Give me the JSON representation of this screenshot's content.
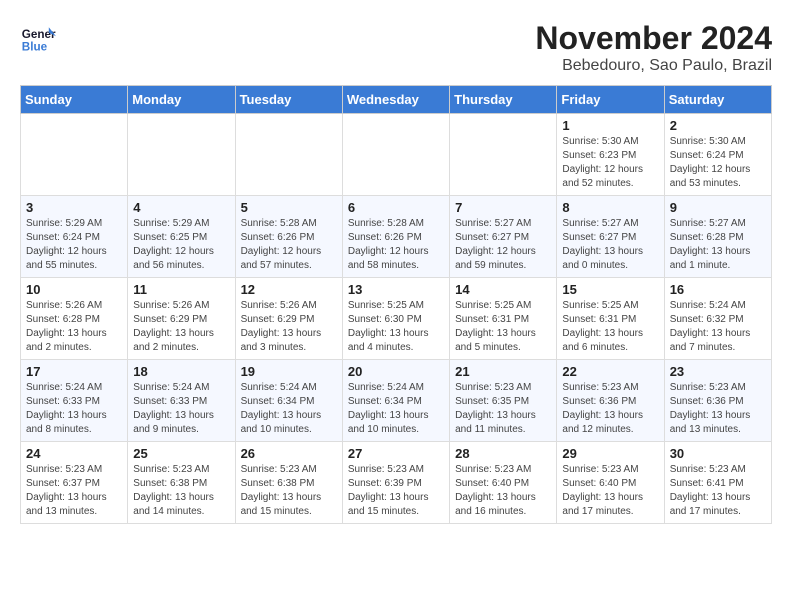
{
  "header": {
    "logo_text_1": "General",
    "logo_text_2": "Blue",
    "month_title": "November 2024",
    "location": "Bebedouro, Sao Paulo, Brazil"
  },
  "weekdays": [
    "Sunday",
    "Monday",
    "Tuesday",
    "Wednesday",
    "Thursday",
    "Friday",
    "Saturday"
  ],
  "weeks": [
    [
      {
        "day": "",
        "info": ""
      },
      {
        "day": "",
        "info": ""
      },
      {
        "day": "",
        "info": ""
      },
      {
        "day": "",
        "info": ""
      },
      {
        "day": "",
        "info": ""
      },
      {
        "day": "1",
        "info": "Sunrise: 5:30 AM\nSunset: 6:23 PM\nDaylight: 12 hours and 52 minutes."
      },
      {
        "day": "2",
        "info": "Sunrise: 5:30 AM\nSunset: 6:24 PM\nDaylight: 12 hours and 53 minutes."
      }
    ],
    [
      {
        "day": "3",
        "info": "Sunrise: 5:29 AM\nSunset: 6:24 PM\nDaylight: 12 hours and 55 minutes."
      },
      {
        "day": "4",
        "info": "Sunrise: 5:29 AM\nSunset: 6:25 PM\nDaylight: 12 hours and 56 minutes."
      },
      {
        "day": "5",
        "info": "Sunrise: 5:28 AM\nSunset: 6:26 PM\nDaylight: 12 hours and 57 minutes."
      },
      {
        "day": "6",
        "info": "Sunrise: 5:28 AM\nSunset: 6:26 PM\nDaylight: 12 hours and 58 minutes."
      },
      {
        "day": "7",
        "info": "Sunrise: 5:27 AM\nSunset: 6:27 PM\nDaylight: 12 hours and 59 minutes."
      },
      {
        "day": "8",
        "info": "Sunrise: 5:27 AM\nSunset: 6:27 PM\nDaylight: 13 hours and 0 minutes."
      },
      {
        "day": "9",
        "info": "Sunrise: 5:27 AM\nSunset: 6:28 PM\nDaylight: 13 hours and 1 minute."
      }
    ],
    [
      {
        "day": "10",
        "info": "Sunrise: 5:26 AM\nSunset: 6:28 PM\nDaylight: 13 hours and 2 minutes."
      },
      {
        "day": "11",
        "info": "Sunrise: 5:26 AM\nSunset: 6:29 PM\nDaylight: 13 hours and 2 minutes."
      },
      {
        "day": "12",
        "info": "Sunrise: 5:26 AM\nSunset: 6:29 PM\nDaylight: 13 hours and 3 minutes."
      },
      {
        "day": "13",
        "info": "Sunrise: 5:25 AM\nSunset: 6:30 PM\nDaylight: 13 hours and 4 minutes."
      },
      {
        "day": "14",
        "info": "Sunrise: 5:25 AM\nSunset: 6:31 PM\nDaylight: 13 hours and 5 minutes."
      },
      {
        "day": "15",
        "info": "Sunrise: 5:25 AM\nSunset: 6:31 PM\nDaylight: 13 hours and 6 minutes."
      },
      {
        "day": "16",
        "info": "Sunrise: 5:24 AM\nSunset: 6:32 PM\nDaylight: 13 hours and 7 minutes."
      }
    ],
    [
      {
        "day": "17",
        "info": "Sunrise: 5:24 AM\nSunset: 6:33 PM\nDaylight: 13 hours and 8 minutes."
      },
      {
        "day": "18",
        "info": "Sunrise: 5:24 AM\nSunset: 6:33 PM\nDaylight: 13 hours and 9 minutes."
      },
      {
        "day": "19",
        "info": "Sunrise: 5:24 AM\nSunset: 6:34 PM\nDaylight: 13 hours and 10 minutes."
      },
      {
        "day": "20",
        "info": "Sunrise: 5:24 AM\nSunset: 6:34 PM\nDaylight: 13 hours and 10 minutes."
      },
      {
        "day": "21",
        "info": "Sunrise: 5:23 AM\nSunset: 6:35 PM\nDaylight: 13 hours and 11 minutes."
      },
      {
        "day": "22",
        "info": "Sunrise: 5:23 AM\nSunset: 6:36 PM\nDaylight: 13 hours and 12 minutes."
      },
      {
        "day": "23",
        "info": "Sunrise: 5:23 AM\nSunset: 6:36 PM\nDaylight: 13 hours and 13 minutes."
      }
    ],
    [
      {
        "day": "24",
        "info": "Sunrise: 5:23 AM\nSunset: 6:37 PM\nDaylight: 13 hours and 13 minutes."
      },
      {
        "day": "25",
        "info": "Sunrise: 5:23 AM\nSunset: 6:38 PM\nDaylight: 13 hours and 14 minutes."
      },
      {
        "day": "26",
        "info": "Sunrise: 5:23 AM\nSunset: 6:38 PM\nDaylight: 13 hours and 15 minutes."
      },
      {
        "day": "27",
        "info": "Sunrise: 5:23 AM\nSunset: 6:39 PM\nDaylight: 13 hours and 15 minutes."
      },
      {
        "day": "28",
        "info": "Sunrise: 5:23 AM\nSunset: 6:40 PM\nDaylight: 13 hours and 16 minutes."
      },
      {
        "day": "29",
        "info": "Sunrise: 5:23 AM\nSunset: 6:40 PM\nDaylight: 13 hours and 17 minutes."
      },
      {
        "day": "30",
        "info": "Sunrise: 5:23 AM\nSunset: 6:41 PM\nDaylight: 13 hours and 17 minutes."
      }
    ]
  ]
}
